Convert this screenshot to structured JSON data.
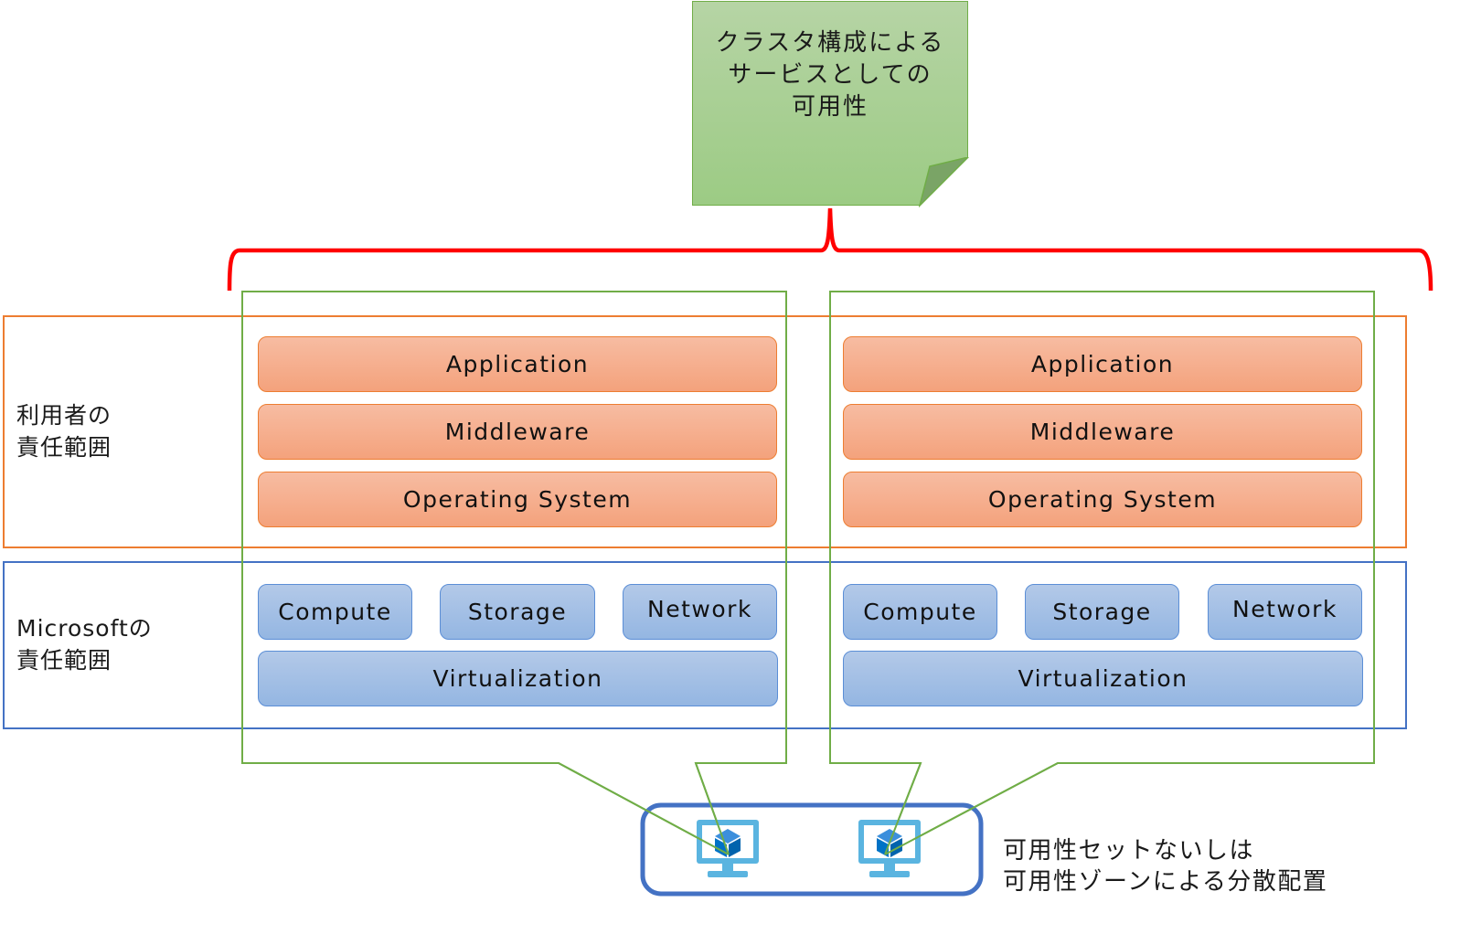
{
  "note": {
    "text": "クラスタ構成による\nサービスとしての\n可用性"
  },
  "zones": {
    "user": {
      "label": "利用者の\n責任範囲",
      "color": "#ed7d31"
    },
    "microsoft": {
      "label": "Microsoftの\n責任範囲",
      "color": "#4472c4"
    }
  },
  "stacks": [
    {
      "user_layers": [
        "Application",
        "Middleware",
        "Operating System"
      ],
      "infra_components": [
        "Compute",
        "Storage",
        "Network"
      ],
      "virtualization": "Virtualization"
    },
    {
      "user_layers": [
        "Application",
        "Middleware",
        "Operating System"
      ],
      "infra_components": [
        "Compute",
        "Storage",
        "Network"
      ],
      "virtualization": "Virtualization"
    }
  ],
  "vms": [
    {
      "icon": "virtual-machine-icon"
    },
    {
      "icon": "virtual-machine-icon"
    }
  ],
  "caption": "可用性セットないしは\n可用性ゾーンによる分散配置",
  "colors": {
    "bracket": "#ff0000",
    "vm_group": "#4472c4",
    "callout": "#70ad47",
    "note_fill": "#a9d18e",
    "vm_monitor": "#5ab4e0",
    "vm_cube": "#0072c6"
  }
}
